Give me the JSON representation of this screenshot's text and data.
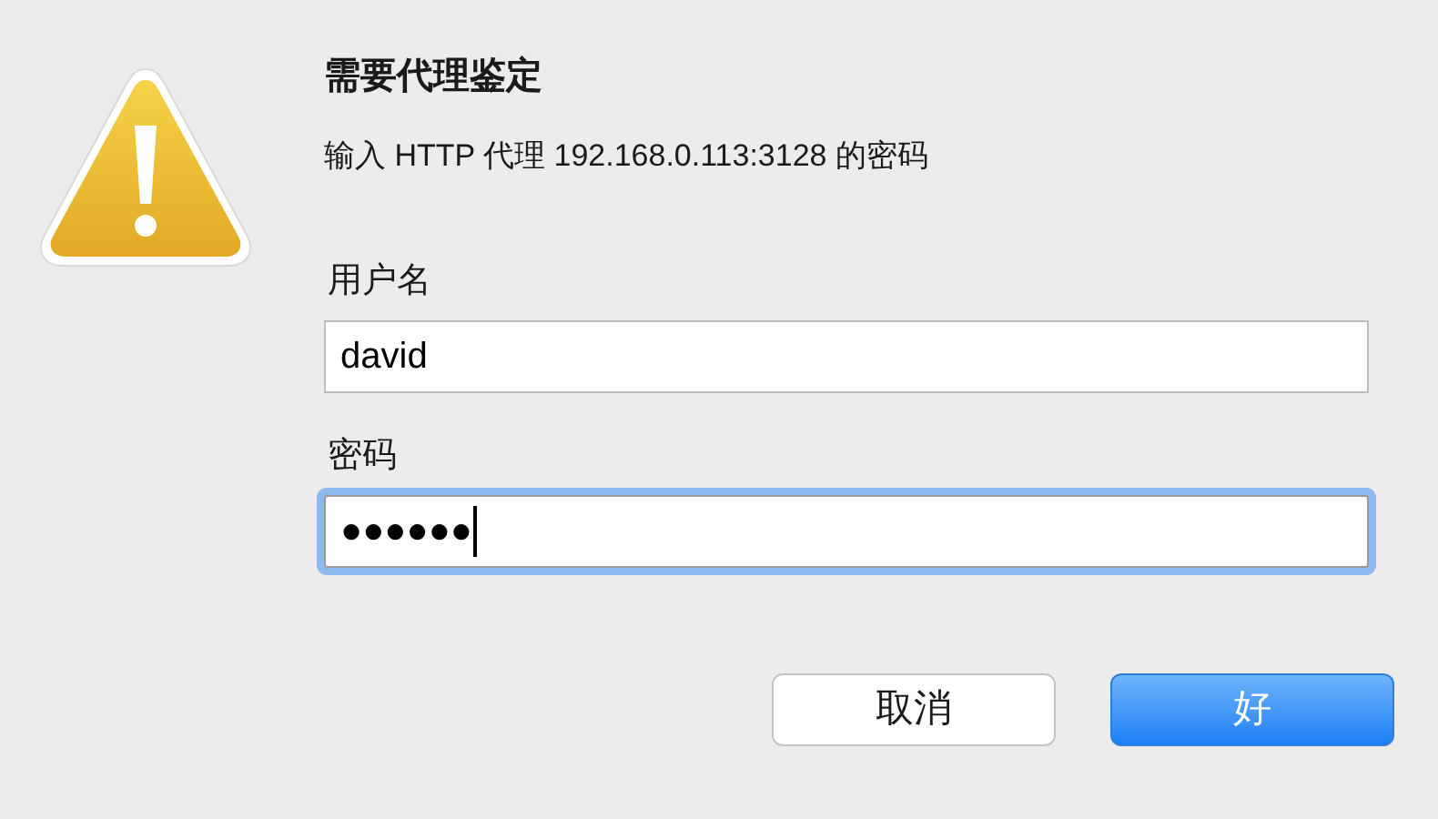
{
  "dialog": {
    "title": "需要代理鉴定",
    "message": "输入 HTTP 代理 192.168.0.113:3128 的密码"
  },
  "fields": [
    {
      "label": "用户名",
      "value": "david",
      "focused": false
    },
    {
      "label": "密码",
      "value": "●●●●●●",
      "focused": true
    }
  ],
  "buttons": [
    {
      "label": "取消",
      "default": false
    },
    {
      "label": "好",
      "default": true
    }
  ]
}
